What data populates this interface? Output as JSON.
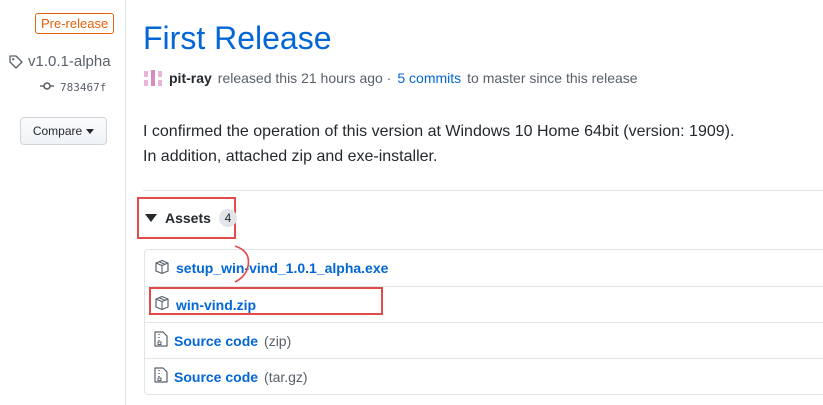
{
  "sidebar": {
    "badge": "Pre-release",
    "tag": "v1.0.1-alpha",
    "commit": "783467f",
    "compare_label": "Compare"
  },
  "release": {
    "title": "First Release",
    "author": "pit-ray",
    "released_text": "released this 21 hours ago ·",
    "commits_link": "5 commits",
    "commits_suffix": "to master since this release",
    "description": [
      "I confirmed the operation of this version at Windows 10 Home 64bit (version: 1909).",
      "In addition, attached zip and exe-installer."
    ]
  },
  "assets": {
    "label": "Assets",
    "count": "4",
    "items": [
      {
        "name": "setup_win-vind_1.0.1_alpha.exe",
        "suffix": "",
        "icon": "package-icon"
      },
      {
        "name": "win-vind.zip",
        "suffix": "",
        "icon": "package-icon"
      },
      {
        "name": "Source code",
        "suffix": "(zip)",
        "icon": "file-zip-icon"
      },
      {
        "name": "Source code",
        "suffix": "(tar.gz)",
        "icon": "file-zip-icon"
      }
    ]
  },
  "colors": {
    "link": "#0366d6",
    "prerelease": "#e36209",
    "annotation": "#e34b4b"
  }
}
